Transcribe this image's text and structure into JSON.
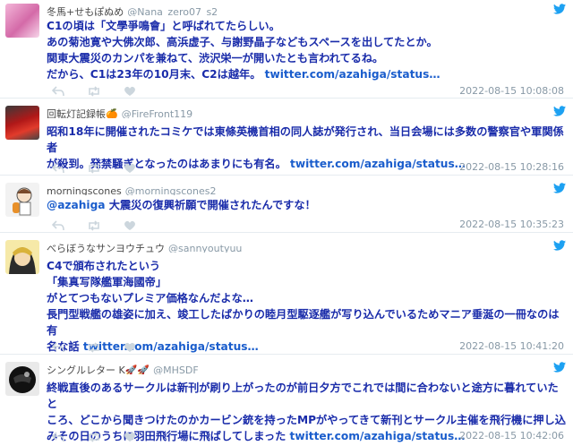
{
  "tweets": [
    {
      "name": "冬馬+せもぽぬめ",
      "handle": "@Nana_zero07_s2",
      "lines": [
        "C1の頃は「文學爭鳴會」と呼ばれてたらしい。",
        "あの菊池寛や大佛次郎、高浜虚子、与謝野晶子などもスペースを出してたとか。",
        "関東大震災のカンパを兼ねて、渋沢栄一が開いたとも言われてるね。",
        "だから、C1は23年の10月末、C2は越年。 "
      ],
      "link": "twitter.com/azahiga/status…",
      "time": "2022-08-15 10:08:08"
    },
    {
      "name": "回転灯記録帳🍊",
      "handle": "@FireFront119",
      "lines": [
        "昭和18年に開催されたコミケでは東條英機首相の同人誌が発行され、当日会場には多数の警察官や軍関係者",
        "が殺到。発禁騒ぎとなったのはあまりにも有名。 "
      ],
      "link": "twitter.com/azahiga/status…",
      "time": "2022-08-15 10:28:16"
    },
    {
      "name": "morningscones",
      "handle": "@morningscones2",
      "mention": "@azahiga",
      "lines": [
        " 大震災の復興祈願で開催されたんですな！"
      ],
      "link": "",
      "time": "2022-08-15 10:35:23"
    },
    {
      "name": "べらぼうなサンヨウチュウ",
      "handle": "@sannyoutyuu",
      "lines": [
        "C4で頒布されたという",
        "「集真写隊艦軍海國帝」",
        "がとてつもないプレミア価格なんだよな…",
        "長門型戦艦の雄姿に加え、竣工したばかりの睦月型駆逐艦が写り込んでいるためマニア垂涎の一冊なのは有",
        "名な話 "
      ],
      "link": "twitter.com/azahiga/status…",
      "time": "2022-08-15 10:41:20"
    },
    {
      "name": "シングルレター K🚀🚀",
      "handle": "@MHSDF",
      "lines": [
        "終戦直後のあるサークルは新刊が刷り上がったのが前日夕方でこれでは間に合わないと途方に暮れていたと",
        "ころ、どこから聞きつけたのかカービン銃を持ったMPがやってきて新刊とサークル主催を飛行機に押し込",
        "みその日のうちに羽田飛行場に飛ばしてしまった "
      ],
      "link": "twitter.com/azahiga/status…",
      "time": "2022-08-15 10:42:06"
    }
  ],
  "colors": {
    "text": "#1a2caa",
    "link": "#1a5dcc",
    "meta": "#8899a6",
    "bird": "#1da1f2"
  }
}
